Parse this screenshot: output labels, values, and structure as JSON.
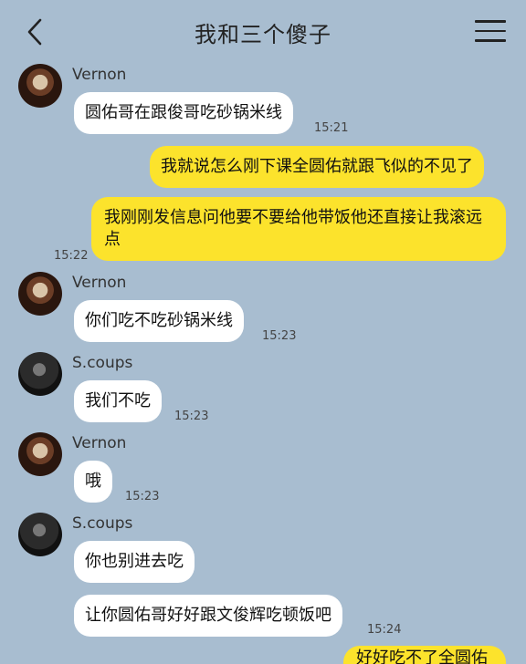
{
  "header": {
    "back_icon": "chevron-left-icon",
    "title": "我和三个傻子",
    "menu_icon": "hamburger-menu-icon"
  },
  "messages": [
    {
      "sender": "Vernon",
      "side": "left",
      "text": "圆佑哥在跟俊哥吃砂锅米线",
      "time": "15:21"
    },
    {
      "side": "right",
      "text": "我就说怎么刚下课全圆佑就跟飞似的不见了"
    },
    {
      "side": "right",
      "text": "我刚刚发信息问他要不要给他带饭他还直接让我滚远点",
      "time": "15:22"
    },
    {
      "sender": "Vernon",
      "side": "left",
      "text": "你们吃不吃砂锅米线",
      "time": "15:23"
    },
    {
      "sender": "S.coups",
      "side": "left",
      "text": "我们不吃",
      "time": "15:23"
    },
    {
      "sender": "Vernon",
      "side": "left",
      "text": "哦",
      "time": "15:23"
    },
    {
      "sender": "S.coups",
      "side": "left",
      "text": "你也别进去吃"
    },
    {
      "side": "left",
      "text": "让你圆佑哥好好跟文俊辉吃顿饭吧",
      "time": "15:24"
    },
    {
      "side": "right",
      "text": "好好吃不了全圆佑"
    }
  ]
}
